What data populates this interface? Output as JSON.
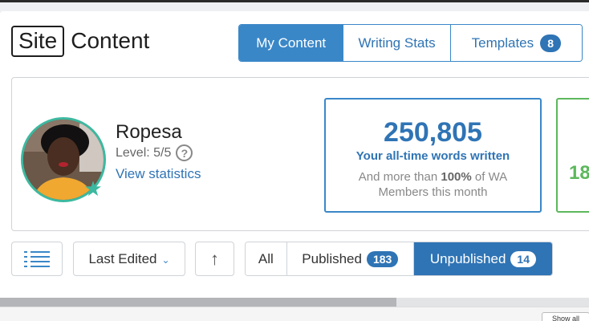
{
  "logo": {
    "boxed_text": "Site",
    "text": "Content"
  },
  "tabs": [
    {
      "label": "My Content",
      "active": true
    },
    {
      "label": "Writing Stats",
      "active": false
    },
    {
      "label": "Templates",
      "active": false,
      "badge": "8"
    }
  ],
  "profile": {
    "name": "Ropesa",
    "level": "Level: 5/5",
    "help_glyph": "?",
    "view_statistics": "View statistics",
    "star_glyph": "★",
    "ring_color": "#3cb9a0"
  },
  "stats": [
    {
      "number": "250,805",
      "caption": "Your all-time words written",
      "sub_prefix": "And more than ",
      "sub_bold": "100%",
      "sub_suffix": " of WA Members this month"
    },
    {
      "number": "18"
    }
  ],
  "controls": {
    "sort_label": "Last Edited",
    "chevron_glyph": "⌄",
    "direction_glyph": "↑"
  },
  "filters": [
    {
      "label": "All",
      "active": false
    },
    {
      "label": "Published",
      "badge": "183",
      "active": false
    },
    {
      "label": "Unpublished",
      "badge": "14",
      "active": true
    }
  ],
  "footer": {
    "show_all": "Show all"
  },
  "colors": {
    "accent": "#3a87c8",
    "link": "#2f74b5",
    "green": "#5cb85c"
  }
}
